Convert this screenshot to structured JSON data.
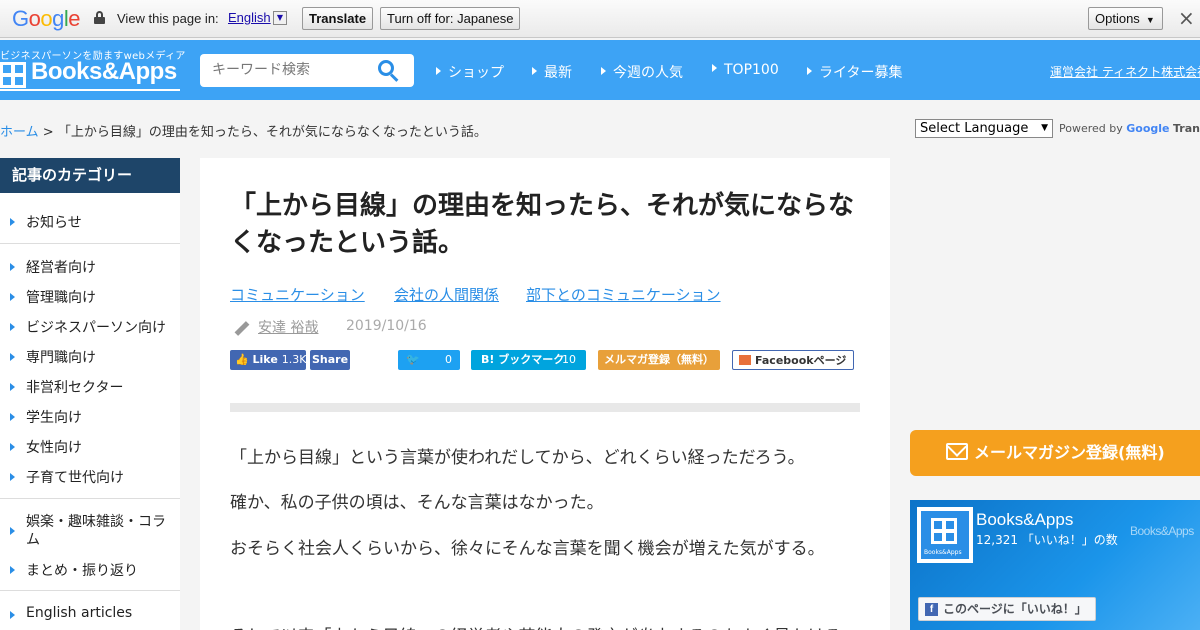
{
  "google_bar": {
    "logo": "Google",
    "view_text": "View this page in:",
    "language": "English",
    "translate_label": "Translate",
    "turn_off_label": "Turn off for: Japanese",
    "options_label": "Options",
    "close_label": "×",
    "colors": {
      "blue": "#4285f4",
      "red": "#ea4335",
      "yellow": "#fbbc05",
      "green": "#34a853"
    }
  },
  "header": {
    "tagline": "ビジネスパーソンを励ますwebメディア",
    "brand": "Books&Apps",
    "search_placeholder": "キーワード検索",
    "nav": [
      "ショップ",
      "最新",
      "今週の人気",
      "TOP100",
      "ライター募集"
    ],
    "company_link": "運営会社 ティネクト株式会社",
    "bg_color": "#3da3f5"
  },
  "breadcrumb": {
    "home": "ホーム",
    "separator": ">",
    "current": "「上から目線」の理由を知ったら、それが気にならなくなったという話。"
  },
  "translate_widget": {
    "select_label": "Select Language",
    "powered_by": "Powered by",
    "google": "Google",
    "translate": "Translate"
  },
  "sidebar": {
    "heading": "記事のカテゴリー",
    "items": [
      "お知らせ",
      "経営者向け",
      "管理職向け",
      "ビジネスパーソン向け",
      "専門職向け",
      "非営利セクター",
      "学生向け",
      "女性向け",
      "子育て世代向け",
      "娯楽・趣味雑談・コラム",
      "まとめ・振り返り",
      "English articles"
    ],
    "heading_color": "#1e4569"
  },
  "article": {
    "title": "「上から目線」の理由を知ったら、それが気にならなくなったという話。",
    "tags": [
      "コミュニケーション",
      "会社の人間関係",
      "部下とのコミュニケーション"
    ],
    "author": "安達 裕哉",
    "date": "2019/10/16",
    "share": {
      "fb_like": "Like",
      "fb_like_count": "1.3K",
      "fb_share": "Share",
      "tweet_count": "0",
      "hatena": "B! ブックマーク",
      "hatena_count": "10",
      "mailmag": "メルマガ登録（無料）",
      "fb_page": "Facebookページ"
    },
    "paragraphs": [
      "「上から目線」という言葉が使われだしてから、どれくらい経っただろう。",
      "確か、私の子供の頃は、そんな言葉はなかった。",
      "おそらく社会人くらいから、徐々にそんな言葉を聞く機会が増えた気がする。",
      "そして以来「上から目線」の経営者や芸能人の発言が炎上するのもよく見かける"
    ]
  },
  "right": {
    "mailmag_button": "メールマガジン登録(無料)",
    "fb_page_name": "Books&Apps",
    "fb_likes": "12,321 「いいね！」の数",
    "fb_watermark": "Books&Apps",
    "fb_logo_text": "Books&Apps",
    "fb_like_page": "このページに「いいね！」",
    "mailmag_color": "#f5a01e"
  }
}
